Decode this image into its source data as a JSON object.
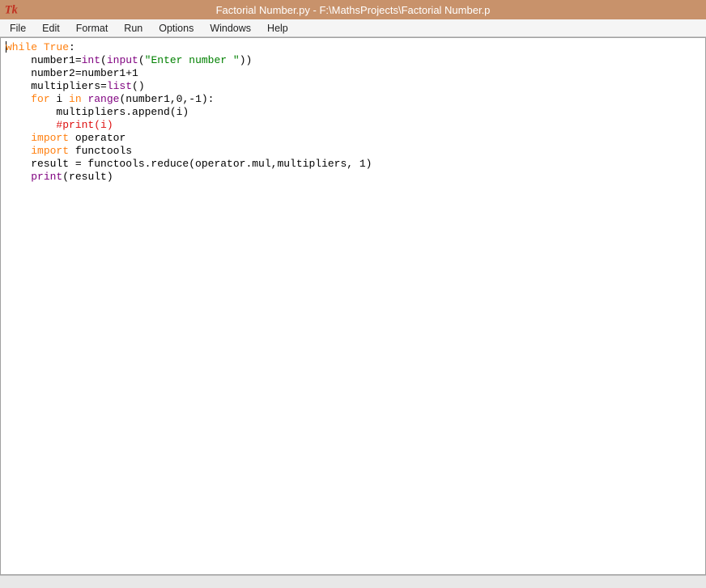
{
  "titlebar": {
    "title": "Factorial Number.py - F:\\MathsProjects\\Factorial Number.p"
  },
  "menubar": {
    "items": [
      "File",
      "Edit",
      "Format",
      "Run",
      "Options",
      "Windows",
      "Help"
    ]
  },
  "code": {
    "line1_kw1": "while",
    "line1_kw2": " True",
    "line1_rest": ":",
    "line2_indent": "    number1=",
    "line2_bi1": "int",
    "line2_paren1": "(",
    "line2_bi2": "input",
    "line2_paren2": "(",
    "line2_str": "\"Enter number \"",
    "line2_rest": "))",
    "line3_indent": "    number2=number1+1",
    "line4_indent": "    multipliers=",
    "line4_bi": "list",
    "line4_rest": "()",
    "line5_indent": "    ",
    "line5_kw1": "for",
    "line5_txt1": " i ",
    "line5_kw2": "in",
    "line5_txt2": " ",
    "line5_bi": "range",
    "line5_rest": "(number1,0,-1):",
    "line6_indent": "        multipliers.append(i)",
    "line7_indent": "        ",
    "line7_cmt": "#print(i)",
    "line8_indent": "    ",
    "line8_kw": "import",
    "line8_rest": " operator",
    "line9_indent": "    ",
    "line9_kw": "import",
    "line9_rest": " functools",
    "line10_indent": "    result = functools.reduce(operator.mul,multipliers, 1)",
    "line11_indent": "    ",
    "line11_bi": "print",
    "line11_rest": "(result)"
  }
}
